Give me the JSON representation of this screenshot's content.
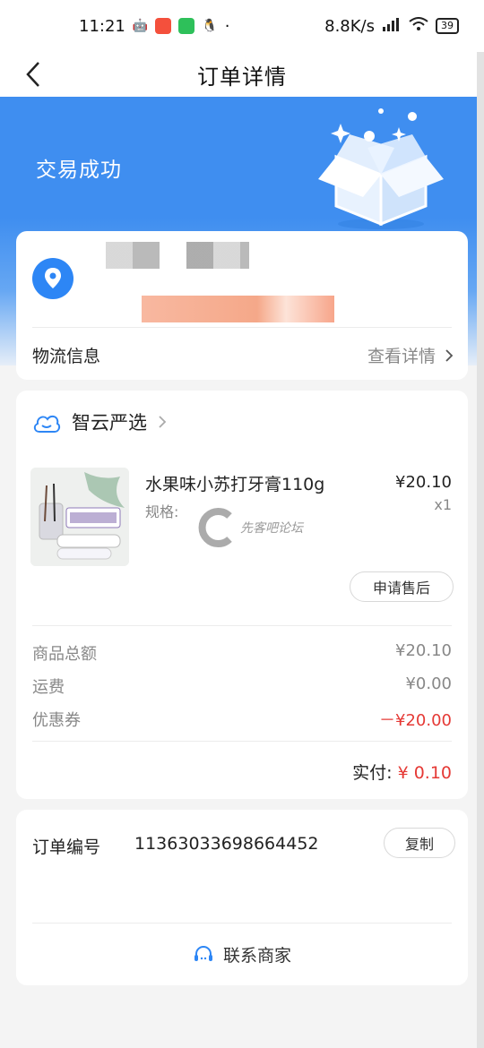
{
  "status_bar": {
    "time": "11:21",
    "net_speed": "8.8K/s",
    "battery": "39"
  },
  "nav": {
    "title": "订单详情"
  },
  "banner": {
    "status": "交易成功"
  },
  "logistics": {
    "label": "物流信息",
    "action": "查看详情"
  },
  "shop": {
    "name": "智云严选"
  },
  "product": {
    "name": "水果味小苏打牙膏110g",
    "spec_label": "规格:",
    "price": "¥20.10",
    "quantity": "x1"
  },
  "watermark": "先客吧论坛",
  "after_sale": {
    "label": "申请售后"
  },
  "summary": {
    "items": [
      {
        "label": "商品总额",
        "value": "¥20.10"
      },
      {
        "label": "运费",
        "value": "¥0.00"
      },
      {
        "label": "优惠券",
        "value": "－¥20.00"
      }
    ],
    "paid_label": "实付:",
    "paid_value": "¥ 0.10"
  },
  "order": {
    "number_label": "订单编号",
    "number": "11363033698664452",
    "copy_label": "复制"
  },
  "contact": {
    "label": "联系商家"
  },
  "colors": {
    "primary": "#3f8ef0",
    "price_red": "#e53935"
  }
}
